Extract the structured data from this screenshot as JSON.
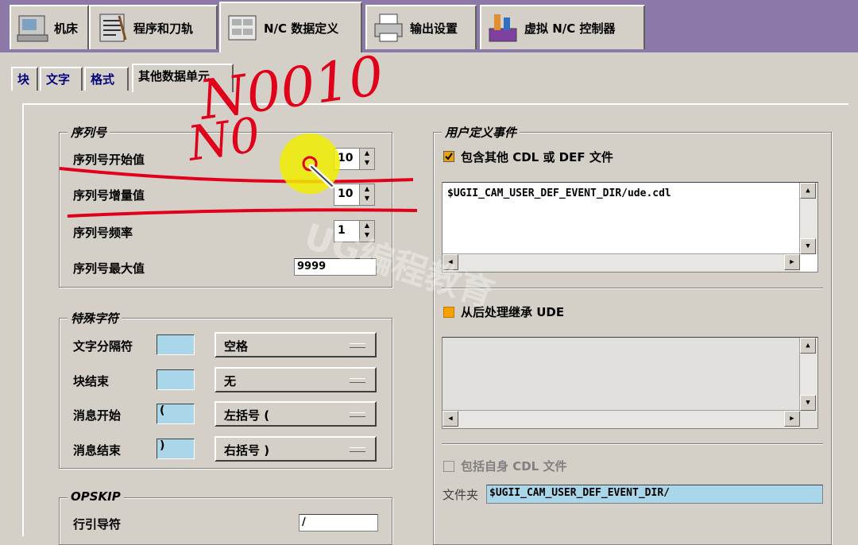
{
  "top_tabs": [
    {
      "label": "机床",
      "icon": "machine-icon"
    },
    {
      "label": "程序和刀轨",
      "icon": "program-icon"
    },
    {
      "label": "N/C 数据定义",
      "icon": "nc-data-icon"
    },
    {
      "label": "输出设置",
      "icon": "printer-icon"
    },
    {
      "label": "虚拟 N/C 控制器",
      "icon": "controller-icon"
    }
  ],
  "sub_tabs": [
    "块",
    "文字",
    "格式",
    "其他数据单元"
  ],
  "sequence_group": {
    "title": "序列号",
    "rows": [
      {
        "label": "序列号开始值",
        "value": "10"
      },
      {
        "label": "序列号增量值",
        "value": "10"
      },
      {
        "label": "序列号频率",
        "value": "1"
      }
    ],
    "max_label": "序列号最大值",
    "max_value": "9999"
  },
  "special_group": {
    "title": "特殊字符",
    "rows": [
      {
        "label": "文字分隔符",
        "char": "",
        "option": "空格"
      },
      {
        "label": "块结束",
        "char": "",
        "option": "无"
      },
      {
        "label": "消息开始",
        "char": "(",
        "option": "左括号 ("
      },
      {
        "label": "消息结束",
        "char": ")",
        "option": "右括号 )"
      }
    ]
  },
  "opskip_group": {
    "title": "OPSKIP",
    "label": "行引导符",
    "value": "/"
  },
  "ude_group": {
    "title": "用户定义事件",
    "include_other_label": "包含其他 CDL 或 DEF 文件",
    "include_other_checked": true,
    "file_list": [
      "$UGII_CAM_USER_DEF_EVENT_DIR/ude.cdl"
    ],
    "inherit_label": "从后处理继承 UDE",
    "inherit_checked": true,
    "include_own_label": "包括自身 CDL 文件",
    "include_own_checked": false,
    "folder_label": "文件夹",
    "folder_value": "$UGII_CAM_USER_DEF_EVENT_DIR/"
  },
  "annotations": {
    "scribble_line1": "N0010",
    "scribble_line2": "N0"
  },
  "watermark": "UG编程教育",
  "colors": {
    "tab_strip": "#8c79a8",
    "field_highlight": "#a9d6e8",
    "annotation_red": "#e0001a",
    "cursor_yellow": "#f0ee00",
    "checkbox_orange": "#f5a100"
  }
}
